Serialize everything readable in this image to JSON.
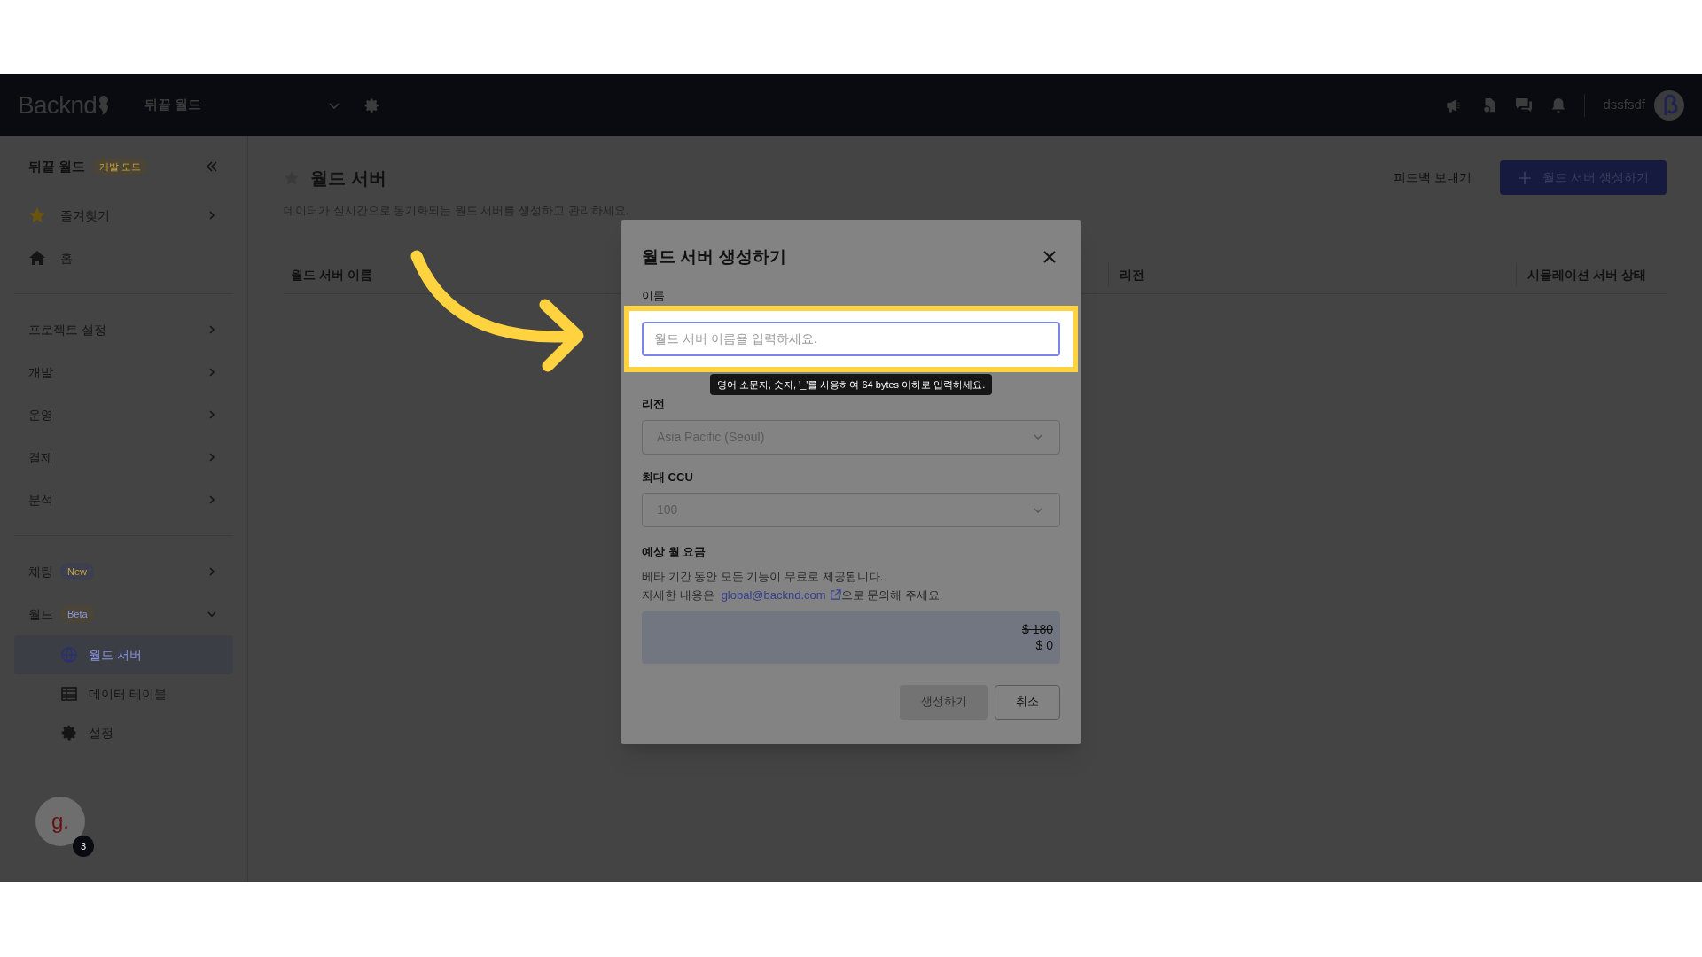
{
  "header": {
    "logo": "Backnd",
    "project": "뒤끝 월드",
    "user": "dssfsdf"
  },
  "sidebar": {
    "title": "뒤끝 월드",
    "title_badge": {
      "text": "개발 모드",
      "color": "#4a4536"
    },
    "items": [
      {
        "kind": "favorite",
        "label": "즐겨찾기",
        "expanded": false
      },
      {
        "kind": "home",
        "label": "홈"
      },
      {
        "kind": "divider"
      },
      {
        "kind": "section",
        "label": "프로젝트 설정",
        "expanded": false
      },
      {
        "kind": "section",
        "label": "개발",
        "expanded": false
      },
      {
        "kind": "section",
        "label": "운영",
        "expanded": false
      },
      {
        "kind": "section",
        "label": "결제",
        "expanded": false
      },
      {
        "kind": "section",
        "label": "분석",
        "expanded": false
      },
      {
        "kind": "divider"
      },
      {
        "kind": "section",
        "label": "채팅",
        "badge": {
          "text": "New",
          "color": "#3c3f4d"
        },
        "expanded": false
      },
      {
        "kind": "section",
        "label": "월드",
        "badge": {
          "text": "Beta",
          "color": "#4a4536"
        },
        "expanded": true,
        "children": [
          {
            "label": "월드 서버",
            "selected": true
          },
          {
            "label": "데이터 테이블",
            "selected": false
          },
          {
            "label": "설정",
            "selected": false
          }
        ]
      }
    ],
    "chat_bubble": {
      "letter": "g.",
      "count": "3"
    }
  },
  "main": {
    "title": "월드 서버",
    "description": "데이터가 실시간으로 동기화되는 월드 서버를 생성하고 관리하세요.",
    "feedback": "피드백 보내기",
    "create_button": "월드 서버 생성하기",
    "table": {
      "columns": [
        "월드 서버 이름",
        "리전",
        "시뮬레이션 서버 상태"
      ]
    }
  },
  "dialog": {
    "title": "월드 서버 생성하기",
    "name_label": "이름",
    "name_placeholder": "월드 서버 이름을 입력하세요.",
    "name_hint": "영어 소문자, 숫자, '_'를 사용하여 64 bytes 이하로 입력하세요.",
    "region_label": "리전",
    "region_value": "Asia Pacific (Seoul)",
    "ccu_label": "최대 CCU",
    "ccu_value": "100",
    "price_label": "예상 월 요금",
    "price_note": "베타 기간 동안 모든 기능이 무료로 제공됩니다.",
    "contact_prefix": "자세한 내용은",
    "contact_email": "global@backnd.com",
    "contact_suffix": "으로 문의해 주세요.",
    "old_price": "$ 180",
    "new_price": "$ 0",
    "buttons": [
      {
        "label": "생성하기",
        "disabled": true
      },
      {
        "label": "취소",
        "disabled": false
      }
    ]
  }
}
